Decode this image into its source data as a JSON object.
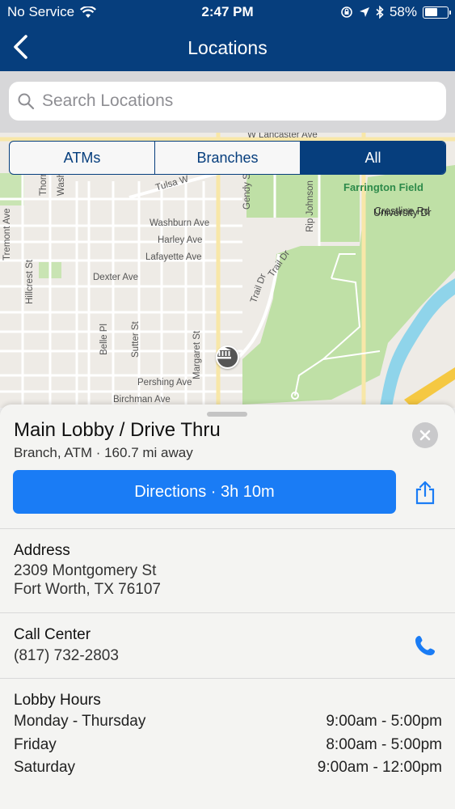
{
  "status_bar": {
    "carrier": "No Service",
    "time": "2:47 PM",
    "battery_percent": "58%",
    "battery_level": 0.58
  },
  "nav": {
    "title": "Locations",
    "back_icon": "chevron-left-icon"
  },
  "search": {
    "placeholder": "Search Locations",
    "value": ""
  },
  "filters": {
    "options": [
      "ATMs",
      "Branches",
      "All"
    ],
    "selected": "All"
  },
  "map": {
    "streets": {
      "lancaster": "W Lancaster Ave",
      "washburn": "Washburn Ave",
      "harley": "Harley Ave",
      "lafayette": "Lafayette Ave",
      "dexter": "Dexter Ave",
      "pershing": "Pershing Ave",
      "birchman": "Birchman Ave",
      "crestline": "Crestline Rd",
      "tulsa": "Tulsa W",
      "tremont": "Tremont Ave",
      "hillcrest": "Hillcrest St",
      "belle": "Belle Pl",
      "sutter": "Sutter St",
      "margaret": "Margaret St",
      "gendy": "Gendy St",
      "rip_johnson": "Rip Johnson",
      "university": "University Dr",
      "trail_dr_1": "Trail Dr",
      "trail_dr_2": "Trail Dr",
      "thorne": "Thorne",
      "washington": "Washi"
    },
    "poi": "Farrington Field",
    "colors": {
      "land": "#eeebe6",
      "park": "#bfe0a6",
      "water": "#8fd4ea",
      "highway": "#f5c842"
    }
  },
  "location": {
    "name": "Main Lobby / Drive Thru",
    "subtitle": "Branch, ATM · 160.7 mi away",
    "directions_label": "Directions · 3h 10m",
    "address_label": "Address",
    "address_line1": "2309 Montgomery St",
    "address_line2": "Fort Worth, TX 76107",
    "call_label": "Call Center",
    "phone": "(817) 732-2803",
    "hours_label": "Lobby Hours",
    "hours": [
      {
        "day": "Monday - Thursday",
        "time": "9:00am - 5:00pm"
      },
      {
        "day": "Friday",
        "time": "8:00am - 5:00pm"
      },
      {
        "day": "Saturday",
        "time": "9:00am - 12:00pm"
      }
    ]
  },
  "theme": {
    "navy": "#063e7d",
    "action_blue": "#1a7cf5"
  }
}
